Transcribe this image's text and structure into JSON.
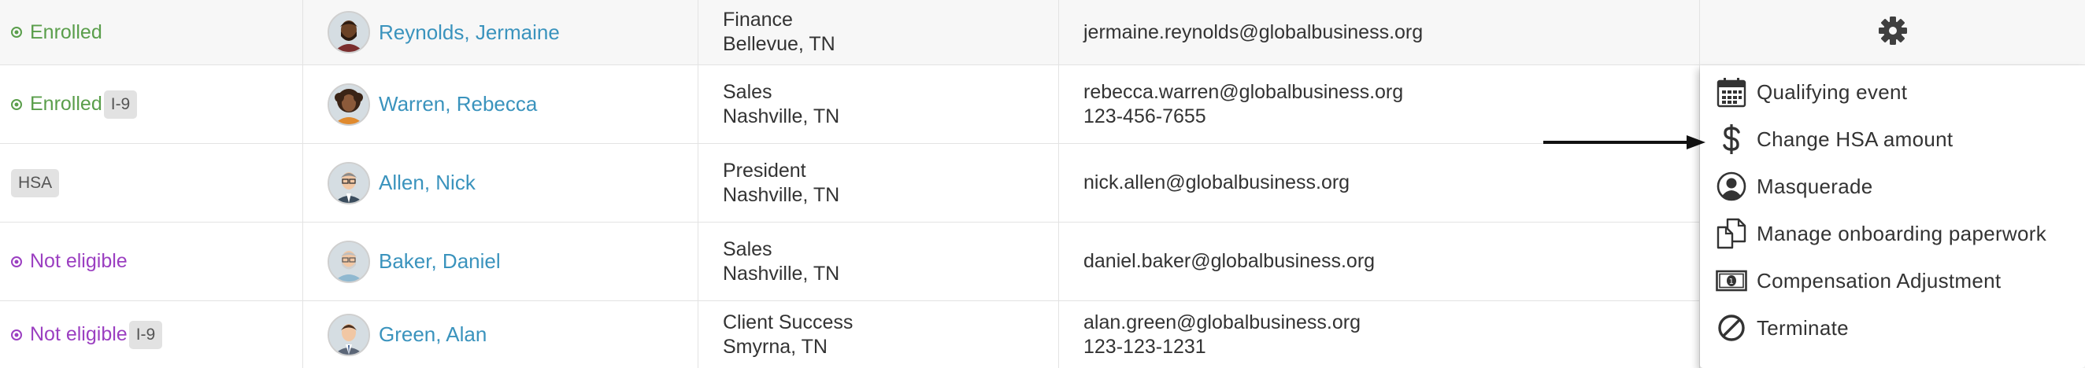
{
  "rows": [
    {
      "status": "Enrolled",
      "badge": "",
      "name": "Reynolds, Jermaine",
      "dept": "Finance",
      "location": "Bellevue, TN",
      "email": "jermaine.reynolds@globalbusiness.org",
      "phone": ""
    },
    {
      "status": "Enrolled",
      "badge": "I-9",
      "name": "Warren, Rebecca",
      "dept": "Sales",
      "location": "Nashville, TN",
      "email": "rebecca.warren@globalbusiness.org",
      "phone": "123-456-7655"
    },
    {
      "status": "",
      "badge": "HSA",
      "name": "Allen, Nick",
      "dept": "President",
      "location": "Nashville, TN",
      "email": "nick.allen@globalbusiness.org",
      "phone": ""
    },
    {
      "status": "Not eligible",
      "badge": "",
      "name": "Baker, Daniel",
      "dept": "Sales",
      "location": "Nashville, TN",
      "email": "daniel.baker@globalbusiness.org",
      "phone": ""
    },
    {
      "status": "Not eligible",
      "badge": "I-9",
      "name": "Green, Alan",
      "dept": "Client Success",
      "location": "Smyrna, TN",
      "email": "alan.green@globalbusiness.org",
      "phone": "123-123-1231"
    }
  ],
  "menu": {
    "items": [
      {
        "label": "Qualifying event",
        "icon": "calendar-icon"
      },
      {
        "label": "Change HSA amount",
        "icon": "dollar-icon"
      },
      {
        "label": "Masquerade",
        "icon": "user-circle-icon"
      },
      {
        "label": "Manage onboarding paperwork",
        "icon": "documents-icon"
      },
      {
        "label": "Compensation Adjustment",
        "icon": "banknote-icon"
      },
      {
        "label": "Terminate",
        "icon": "ban-icon"
      }
    ]
  },
  "colors": {
    "enrolled": "#5a9e4b",
    "not_eligible": "#9b3fc1",
    "link": "#3a93bd",
    "header_row_bg": "#f7f7f7"
  }
}
